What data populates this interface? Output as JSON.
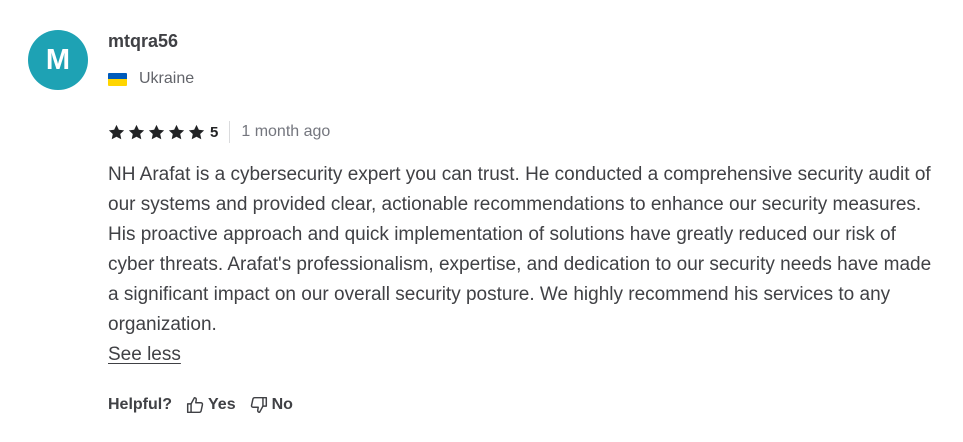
{
  "reviewer": {
    "avatar_letter": "M",
    "avatar_color": "#1ea2b4",
    "username": "mtqra56",
    "country": "Ukraine",
    "flag_colors": {
      "top": "#005bbb",
      "bottom": "#ffd500"
    }
  },
  "rating": {
    "stars": 5,
    "value": "5",
    "star_color": "#222325"
  },
  "time_ago": "1 month ago",
  "review_text": "NH Arafat is a cybersecurity expert you can trust. He conducted a comprehensive security audit of our systems and provided clear, actionable recommendations to enhance our security measures. His proactive approach and quick implementation of solutions have greatly reduced our risk of cyber threats. Arafat's professionalism, expertise, and dedication to our security needs have made a significant impact on our overall security posture. We highly recommend his services to any organization.",
  "see_less_label": "See less",
  "helpful": {
    "label": "Helpful?",
    "yes_label": "Yes",
    "no_label": "No",
    "yes_icon": "thumbs-up-icon",
    "no_icon": "thumbs-down-icon"
  }
}
